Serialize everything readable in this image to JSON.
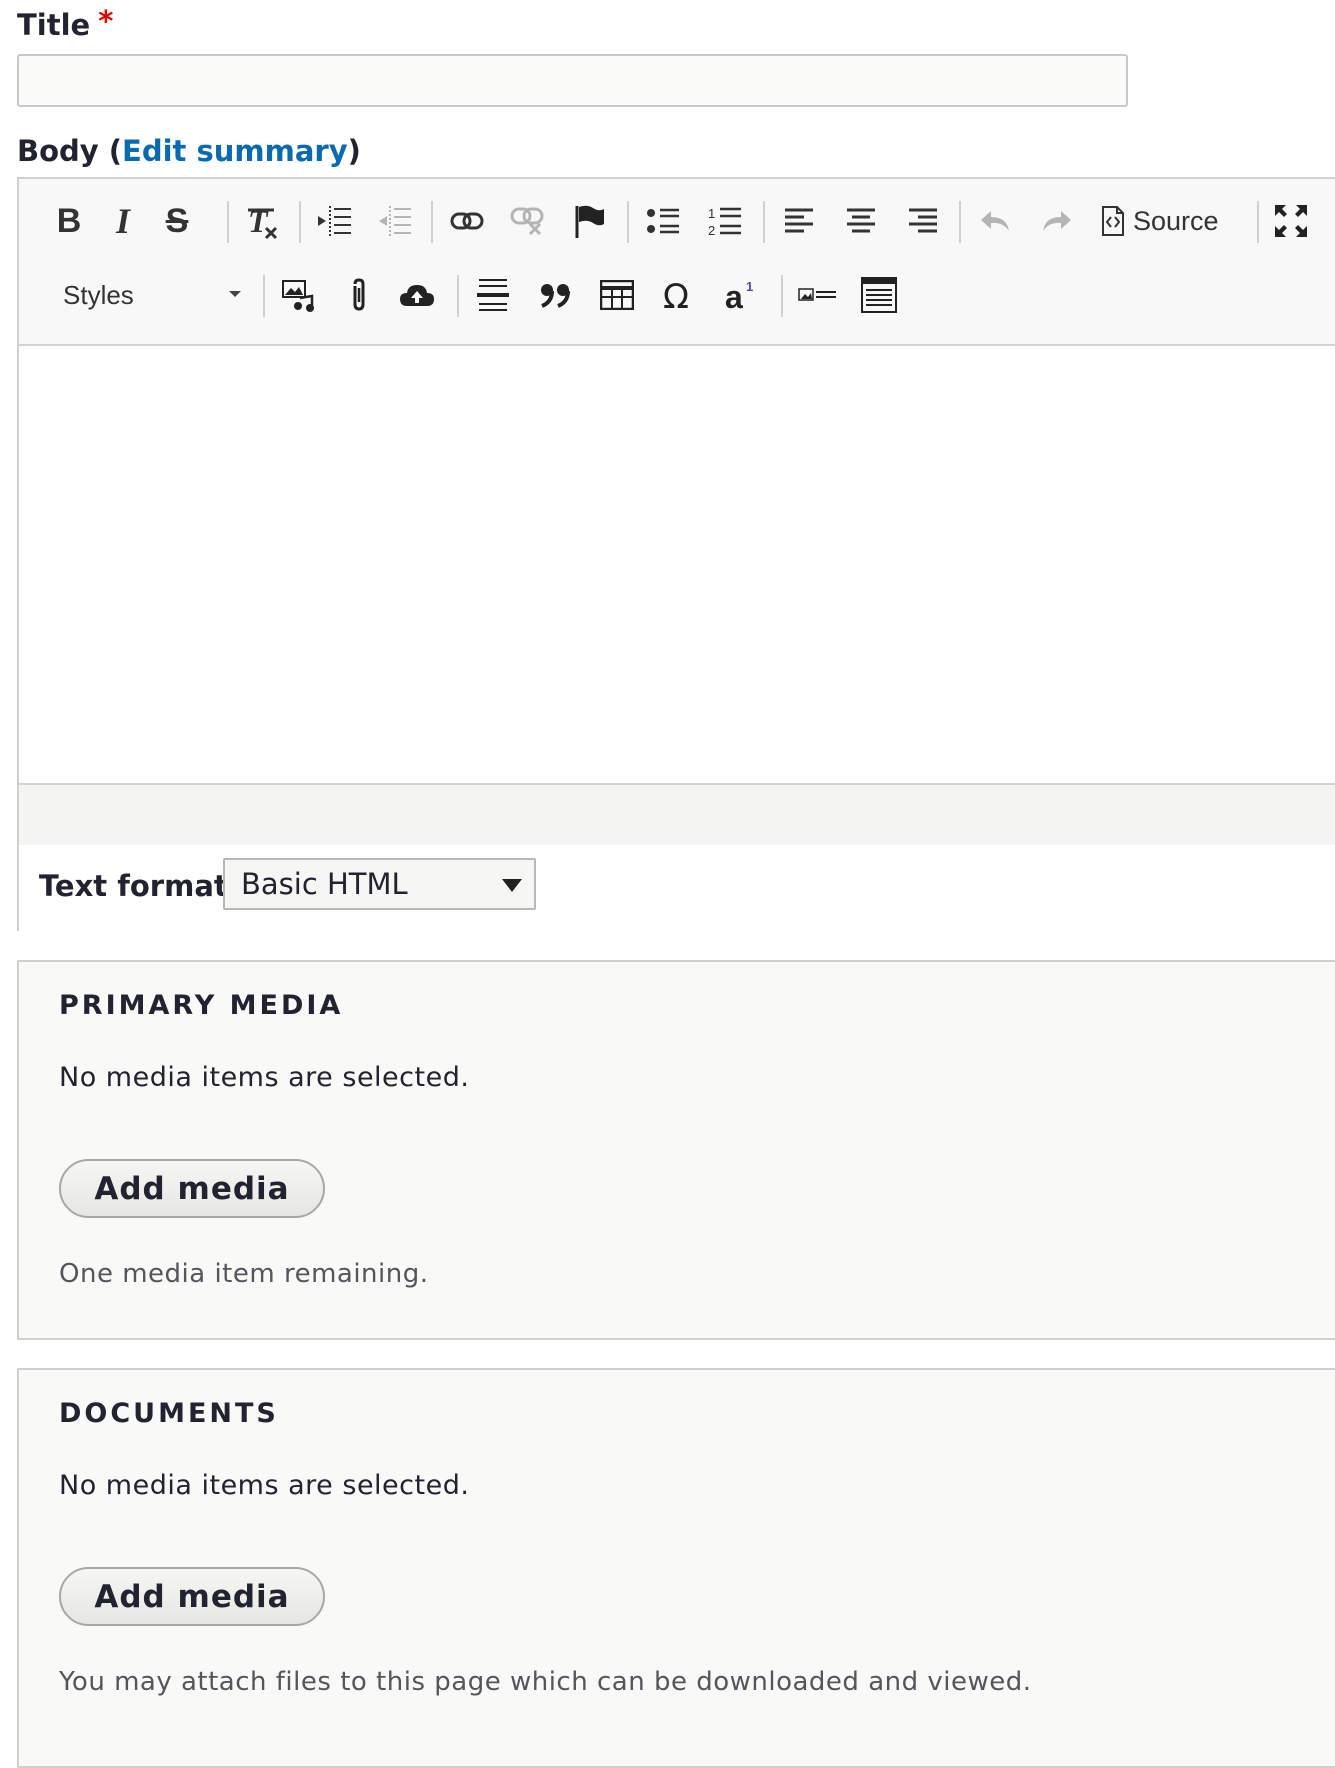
{
  "title_field": {
    "label": "Title",
    "required_marker": "*",
    "value": ""
  },
  "body_field": {
    "label_prefix": "Body (",
    "link_label": "Edit summary",
    "label_suffix": ")"
  },
  "toolbar": {
    "bold": "B",
    "italic": "I",
    "strike": "S",
    "source_label": "Source",
    "styles_label": "Styles",
    "icons": [
      "bold-icon",
      "italic-icon",
      "strikethrough-icon",
      "remove-format-icon",
      "indent-icon",
      "outdent-icon",
      "link-icon",
      "unlink-icon",
      "anchor-flag-icon",
      "bulleted-list-icon",
      "numbered-list-icon",
      "align-left-icon",
      "align-center-icon",
      "align-right-icon",
      "undo-icon",
      "redo-icon",
      "source-icon",
      "maximize-icon",
      "media-embed-icon",
      "attachment-icon",
      "cloud-upload-icon",
      "horizontal-rule-icon",
      "blockquote-icon",
      "table-icon",
      "special-char-icon",
      "superscript-icon",
      "image-caption-icon",
      "template-icon"
    ]
  },
  "text_format": {
    "label": "Text format",
    "selected": "Basic HTML"
  },
  "primary_media": {
    "title": "PRIMARY MEDIA",
    "empty_text": "No media items are selected.",
    "button_label": "Add media",
    "description": "One media item remaining."
  },
  "documents": {
    "title": "DOCUMENTS",
    "empty_text": "No media items are selected.",
    "button_label": "Add media",
    "description": "You may attach files to this page which can be downloaded and viewed."
  },
  "colors": {
    "link": "#0a6aaf",
    "required": "#e00000"
  }
}
